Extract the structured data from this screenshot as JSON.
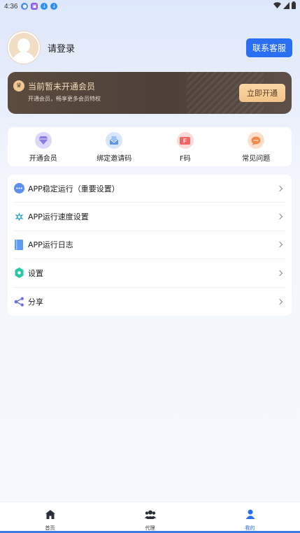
{
  "status_bar": {
    "time": "4:36",
    "left_icons": [
      "notification-icon",
      "calendar-icon",
      "download-icon",
      "download-icon"
    ],
    "right_icons": [
      "wifi-icon",
      "signal-icon",
      "battery-icon"
    ]
  },
  "profile": {
    "login_text": "请登录",
    "contact_button": "联系客服"
  },
  "vip_card": {
    "title": "当前暂未开通会员",
    "subtitle": "开通会员，畅享更多会员特权",
    "button": "立即开通",
    "crown_icon": "crown-icon"
  },
  "quick_actions": [
    {
      "label": "开通会员",
      "icon": "diamond-icon",
      "bg": "#dcd8fb",
      "color": "#8b7be8"
    },
    {
      "label": "绑定邀请码",
      "icon": "envelope-icon",
      "bg": "#d7e6fb",
      "color": "#5e95e6"
    },
    {
      "label": "F码",
      "icon": "ticket-icon",
      "bg": "#fbdada",
      "color": "#ee6666"
    },
    {
      "label": "常见问题",
      "icon": "question-icon",
      "bg": "#fde0cc",
      "color": "#f08a4b"
    }
  ],
  "menu": [
    {
      "label": "APP稳定运行（重要设置）",
      "icon": "dots-icon"
    },
    {
      "label": "APP运行速度设置",
      "icon": "speed-icon"
    },
    {
      "label": "APP运行日志",
      "icon": "log-book-icon"
    },
    {
      "label": "设置",
      "icon": "settings-icon"
    },
    {
      "label": "分享",
      "icon": "share-icon"
    }
  ],
  "bottom_nav": [
    {
      "label": "首页",
      "icon": "home-icon",
      "active": false
    },
    {
      "label": "代理",
      "icon": "group-icon",
      "active": false
    },
    {
      "label": "我的",
      "icon": "user-icon",
      "active": true
    }
  ],
  "colors": {
    "accent": "#2a6ef2",
    "vip_gold": "#f5dbb8",
    "vip_bg": "#4c4039"
  }
}
